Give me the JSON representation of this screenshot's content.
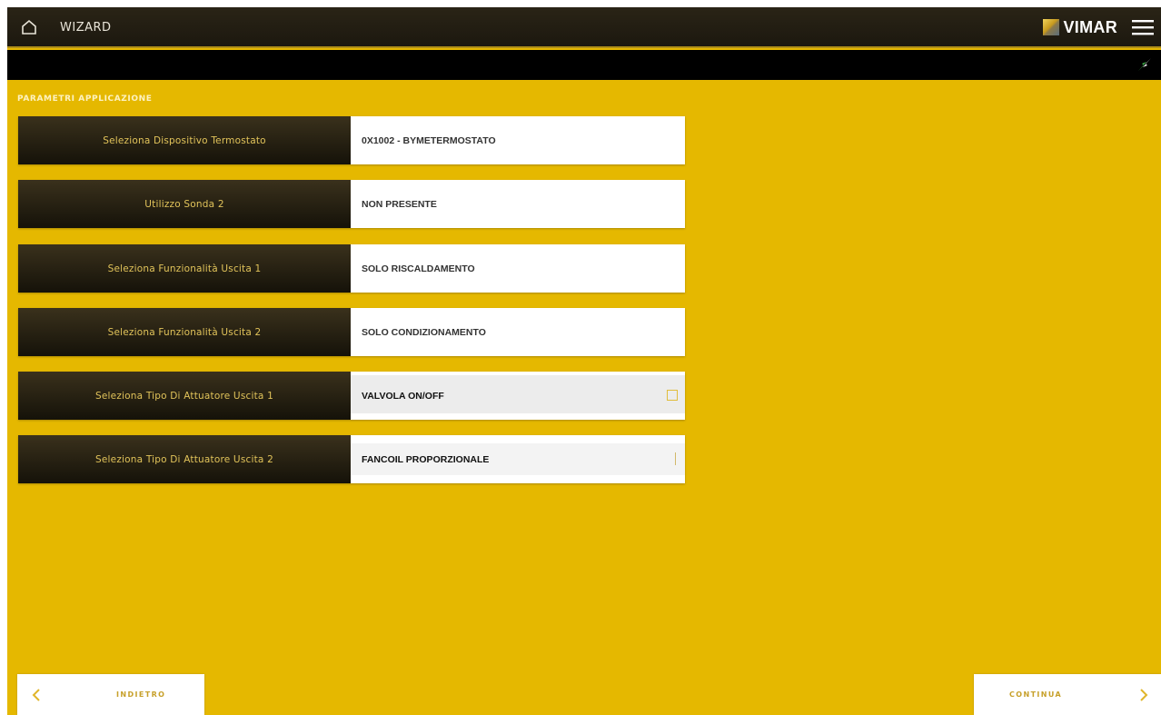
{
  "header": {
    "title": "WIZARD",
    "logo_text": "VIMAR",
    "icons": {
      "home": "home-icon",
      "menu": "hamburger-menu-icon",
      "status": "connection-status-icon"
    }
  },
  "section": {
    "title": "PARAMETRI APPLICAZIONE"
  },
  "params": [
    {
      "label": "Seleziona Dispositivo Termostato",
      "value": "0X1002 - BYMETERMOSTATO"
    },
    {
      "label": "Utilizzo Sonda 2",
      "value": "NON PRESENTE"
    },
    {
      "label": "Seleziona Funzionalità Uscita 1",
      "value": "SOLO RISCALDAMENTO"
    },
    {
      "label": "Seleziona Funzionalità Uscita 2",
      "value": "SOLO CONDIZIONAMENTO"
    },
    {
      "label": "Seleziona Tipo Di Attuatore Uscita 1",
      "value": "VALVOLA ON/OFF"
    },
    {
      "label": "Seleziona Tipo Di Attuatore Uscita 2",
      "value": "FANCOIL PROPORZIONALE"
    }
  ],
  "footer": {
    "back_label": "INDIETRO",
    "next_label": "CONTINUA"
  },
  "colors": {
    "background": "#e5b800",
    "header": "#1c180f",
    "label_text": "#e1c35a",
    "accent": "#c7a02a"
  }
}
